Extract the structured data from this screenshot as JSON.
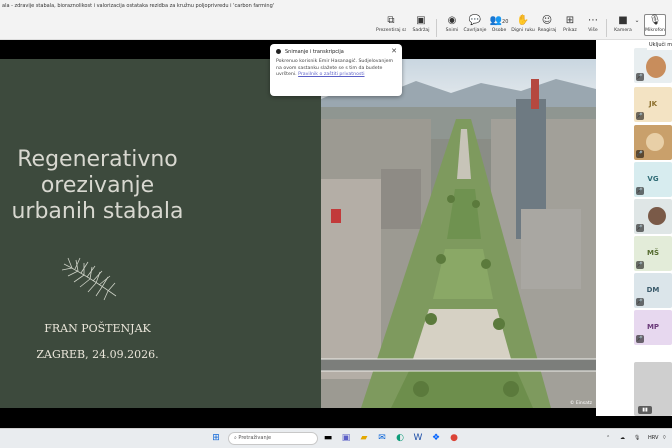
{
  "window": {
    "title": "ala - zdravije stabala, bioraznolikost i valorizacija ostataka rezidba za kružnu poljoprivredu i 'carbon farming'"
  },
  "toolbar": {
    "items": [
      {
        "label": "Prezentiraj sadržaj",
        "icon": "share-screen-icon"
      },
      {
        "label": "Sadržaj",
        "icon": "content-icon"
      },
      {
        "label": "Snimi",
        "icon": "record-icon"
      },
      {
        "label": "Čavrljanje",
        "icon": "chat-icon"
      },
      {
        "label": "Osobe",
        "icon": "people-icon",
        "count": "20"
      },
      {
        "label": "Digni ruku",
        "icon": "raise-hand-icon"
      },
      {
        "label": "Reagiraj",
        "icon": "react-icon"
      },
      {
        "label": "Prikaz",
        "icon": "view-icon"
      },
      {
        "label": "Više",
        "icon": "more-icon"
      },
      {
        "label": "Kamera",
        "icon": "camera-icon"
      },
      {
        "label": "Mikrofon",
        "icon": "mic-off-icon"
      }
    ],
    "mic_tooltip": "Uključi mi"
  },
  "notice": {
    "title": "Snimanje i transkripcija",
    "body": "Pokrenuo korisnik Emir Hasanagić. Sudjelovanjem na ovom sastanku slažete se s tim da budete uvršteni.",
    "link": "Pravilnik o zaštiti privatnosti"
  },
  "slide": {
    "title_line1": "Regenerativno",
    "title_line2": "orezivanje",
    "title_line3": "urbanih stabala",
    "author": "FRAN POŠTENJAK",
    "date": "ZAGREB, 24.09.2026.",
    "photo_credit": "© Einsatz",
    "bg_color": "#3d4a3d"
  },
  "participants": [
    {
      "initials": "",
      "type": "video",
      "color": "#e8eef0"
    },
    {
      "initials": "JK",
      "type": "avatar",
      "color": "#f3e3c3",
      "text_color": "#8a6d2a"
    },
    {
      "initials": "",
      "type": "video",
      "color": "#c9a06b"
    },
    {
      "initials": "VG",
      "type": "avatar",
      "color": "#d7ecef",
      "text_color": "#2e6b75"
    },
    {
      "initials": "",
      "type": "video",
      "color": "#dfe6e6"
    },
    {
      "initials": "MŠ",
      "type": "avatar",
      "color": "#e3ecd9",
      "text_color": "#556b2f"
    },
    {
      "initials": "DM",
      "type": "avatar",
      "color": "#dbe5ea",
      "text_color": "#3b5b6b"
    },
    {
      "initials": "MP",
      "type": "avatar",
      "color": "#e7d8ef",
      "text_color": "#6b3b7a"
    },
    {
      "initials": "",
      "type": "video",
      "color": "#cfcfcf"
    }
  ],
  "taskbar": {
    "search_placeholder": "Pretraživanje",
    "lang": "HRV"
  }
}
